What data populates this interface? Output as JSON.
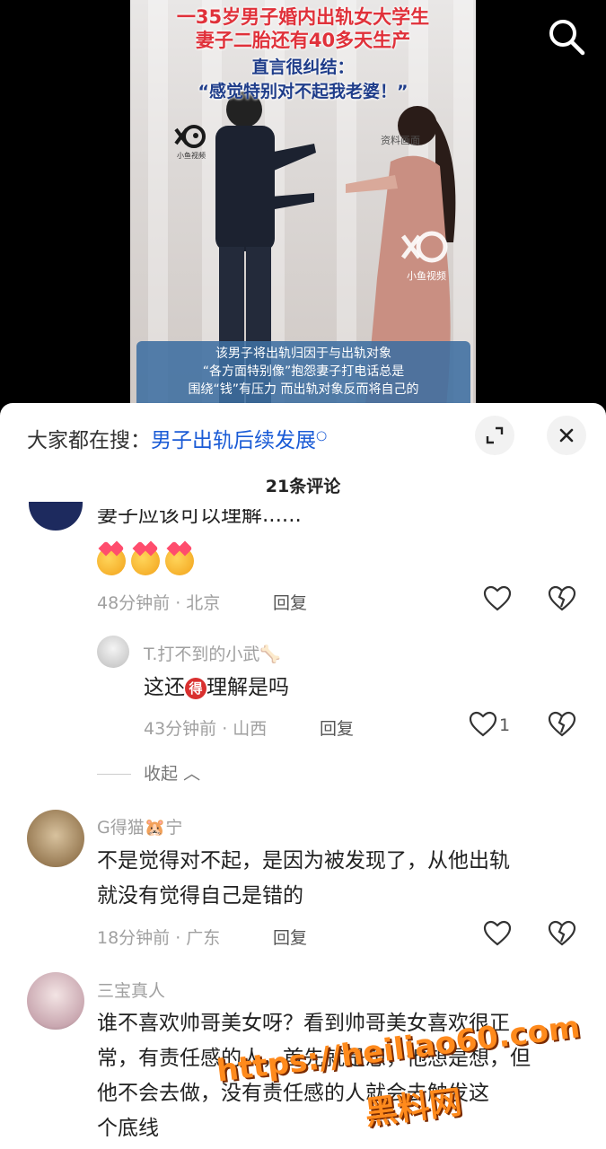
{
  "video": {
    "headline_line1": "一35岁男子婚内出轨女大学生",
    "headline_line2": "妻子二胎还有40多天生产",
    "headline_line3": "直言很纠结：",
    "headline_line4": "“感觉特别对不起我老婆！”",
    "logo_caption": "小鱼视频",
    "watermark_tag": "资料画面",
    "logo2_caption": "小鱼视频",
    "caption_line1": "该男子将出轨归因于与出轨对象",
    "caption_line2": "“各方面特别像”抱怨妻子打电话总是",
    "caption_line3": "围绕“钱”有压力 而出轨对象反而将自己的"
  },
  "panel": {
    "hot_search_prefix": "大家都在搜：",
    "hot_search_keyword": "男子出轨后续发展",
    "comment_count": "21条评论"
  },
  "comments": [
    {
      "text_partial": "妻子应该可以理解......",
      "time": "48分钟前 · 北京",
      "reply": "回复"
    },
    {
      "user": "T.打不到的小武",
      "text_before": "这还",
      "badge": "得",
      "text_after": "理解是吗",
      "time": "43分钟前 · 山西",
      "reply": "回复",
      "likes": "1"
    },
    {
      "collapse": "收起"
    },
    {
      "user": "G得猫",
      "user_suffix": "宁",
      "text_line1": "不是觉得对不起，是因为被发现了，从他出轨",
      "text_line2": "就没有觉得自己是错的",
      "time": "18分钟前 · 广东",
      "reply": "回复"
    },
    {
      "user": "三宝真人",
      "text_line1": "谁不喜欢帅哥美女呀？看到帅哥美女喜欢很正",
      "text_line2": "常，有责任感的人，首先就是想，他想是想，但",
      "text_line3": "他不会去做，没有责任感的人就会去触发这",
      "text_line4": "个底线"
    }
  ],
  "watermark": {
    "url": "https://heiliao60.com",
    "brand": "黑料网"
  }
}
